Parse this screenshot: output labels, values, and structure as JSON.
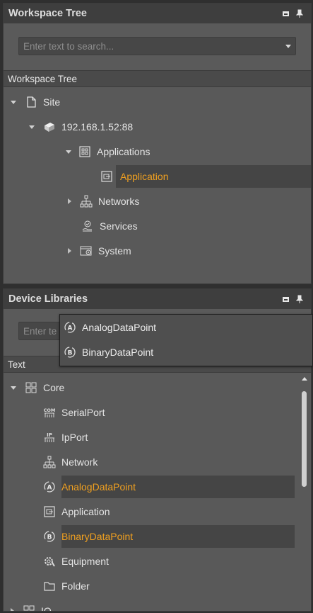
{
  "workspace": {
    "title": "Workspace Tree",
    "search_placeholder": "Enter text to search...",
    "column_header": "Workspace Tree",
    "tree": [
      {
        "label": "Site",
        "icon": "page-icon",
        "expander": "down"
      },
      {
        "label": "192.168.1.52:88",
        "icon": "server-icon",
        "expander": "down"
      },
      {
        "label": "Applications",
        "icon": "applications-icon",
        "expander": "down"
      },
      {
        "label": "Application",
        "icon": "application-icon",
        "expander": "none",
        "selected": true
      },
      {
        "label": "Networks",
        "icon": "network-icon",
        "expander": "right"
      },
      {
        "label": "Services",
        "icon": "services-icon",
        "expander": "none"
      },
      {
        "label": "System",
        "icon": "system-icon",
        "expander": "right"
      }
    ]
  },
  "libraries": {
    "title": "Device Libraries",
    "search_placeholder": "Enter te",
    "column_header": "Text",
    "tree": [
      {
        "label": "Core",
        "icon": "grid-icon",
        "expander": "down"
      },
      {
        "label": "SerialPort",
        "icon": "com-port-icon"
      },
      {
        "label": "IpPort",
        "icon": "ip-port-icon"
      },
      {
        "label": "Network",
        "icon": "network-icon"
      },
      {
        "label": "AnalogDataPoint",
        "icon": "analog-datapoint-icon",
        "selected": true
      },
      {
        "label": "Application",
        "icon": "application-icon"
      },
      {
        "label": "BinaryDataPoint",
        "icon": "binary-datapoint-icon",
        "selected": true
      },
      {
        "label": "Equipment",
        "icon": "equipment-icon"
      },
      {
        "label": "Folder",
        "icon": "folder-icon"
      },
      {
        "label": "IO",
        "icon": "grid-icon",
        "expander": "right"
      }
    ]
  },
  "popup": {
    "items": [
      {
        "label": "AnalogDataPoint",
        "icon": "analog-datapoint-icon"
      },
      {
        "label": "BinaryDataPoint",
        "icon": "binary-datapoint-icon"
      }
    ]
  },
  "colors": {
    "selected_text": "#f0a020",
    "panel_bg": "#5a5a5a",
    "header_bg": "#3e3e3e"
  }
}
